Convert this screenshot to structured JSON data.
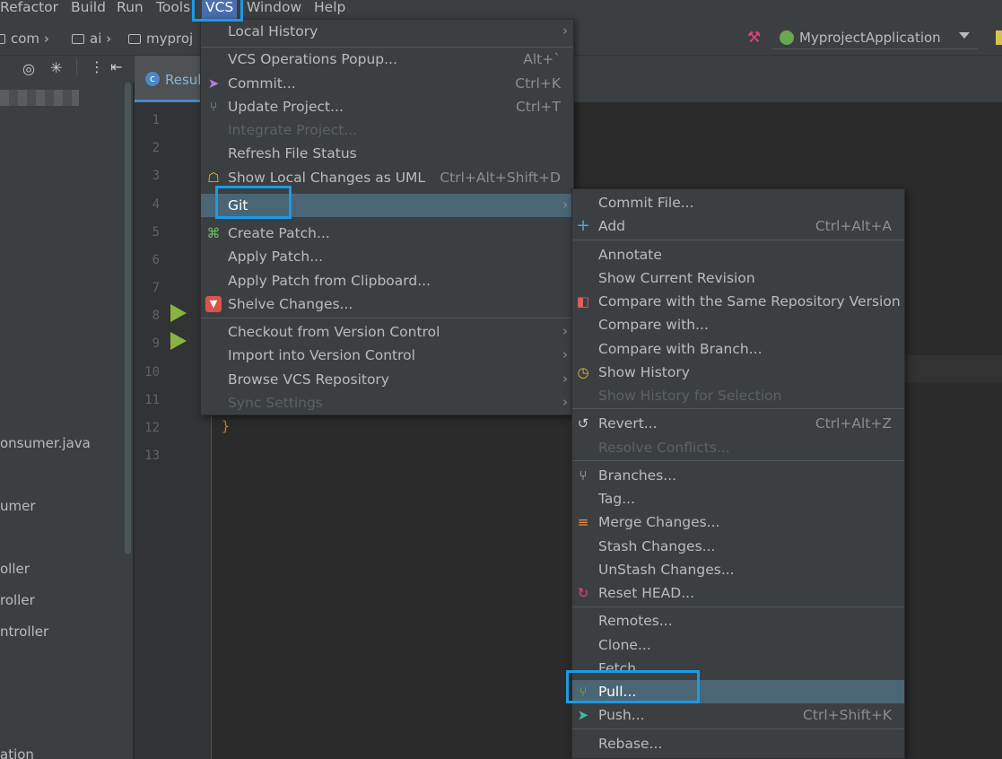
{
  "menubar": {
    "items": [
      {
        "label": "Refactor"
      },
      {
        "label": "Build"
      },
      {
        "label": "Run"
      },
      {
        "label": "Tools"
      },
      {
        "label": "VCS"
      },
      {
        "label": "Window"
      },
      {
        "label": "Help"
      }
    ]
  },
  "breadcrumbs": [
    "com",
    "ai",
    "myproj"
  ],
  "run_config": {
    "label": "MyprojectApplication"
  },
  "editor_tab": {
    "label": "Resul"
  },
  "project_tree": [
    "onsumer.java",
    "umer",
    "oller",
    "roller",
    "ntroller",
    "ation"
  ],
  "line_numbers": [
    "1",
    "2",
    "3",
    "4",
    "5",
    "6",
    "7",
    "8",
    "9",
    "10",
    "11",
    "12",
    "13"
  ],
  "code": {
    "closing_brace": "}"
  },
  "vcs_menu": {
    "items": [
      {
        "label": "Local History",
        "shortcut": "",
        "submenu": true
      },
      {
        "label": "VCS Operations Popup...",
        "shortcut": "Alt+`"
      },
      {
        "label": "Commit...",
        "shortcut": "Ctrl+K",
        "icon": "commit-icon"
      },
      {
        "label": "Update Project...",
        "shortcut": "Ctrl+T",
        "icon": "update-icon"
      },
      {
        "label": "Integrate Project...",
        "shortcut": "",
        "disabled": true
      },
      {
        "label": "Refresh File Status",
        "shortcut": ""
      },
      {
        "label": "Show Local Changes as UML",
        "shortcut": "Ctrl+Alt+Shift+D",
        "icon": "uml-icon"
      },
      {
        "label": "Git",
        "shortcut": "",
        "submenu": true,
        "selected": true
      },
      {
        "label": "Create Patch...",
        "shortcut": "",
        "icon": "patch-icon"
      },
      {
        "label": "Apply Patch...",
        "shortcut": ""
      },
      {
        "label": "Apply Patch from Clipboard...",
        "shortcut": ""
      },
      {
        "label": "Shelve Changes...",
        "shortcut": "",
        "icon": "shelve-icon"
      },
      {
        "label": "Checkout from Version Control",
        "shortcut": "",
        "submenu": true
      },
      {
        "label": "Import into Version Control",
        "shortcut": "",
        "submenu": true
      },
      {
        "label": "Browse VCS Repository",
        "shortcut": "",
        "submenu": true
      },
      {
        "label": "Sync Settings",
        "shortcut": "",
        "submenu": true,
        "disabled": true
      }
    ]
  },
  "git_menu": {
    "items": [
      {
        "label": "Commit File...",
        "shortcut": ""
      },
      {
        "label": "Add",
        "shortcut": "Ctrl+Alt+A",
        "icon": "plus-icon"
      },
      {
        "label": "Annotate",
        "shortcut": ""
      },
      {
        "label": "Show Current Revision",
        "shortcut": ""
      },
      {
        "label": "Compare with the Same Repository Version",
        "shortcut": "",
        "icon": "compare-icon"
      },
      {
        "label": "Compare with...",
        "shortcut": ""
      },
      {
        "label": "Compare with Branch...",
        "shortcut": ""
      },
      {
        "label": "Show History",
        "shortcut": "",
        "icon": "history-icon"
      },
      {
        "label": "Show History for Selection",
        "shortcut": "",
        "disabled": true
      },
      {
        "label": "Revert...",
        "shortcut": "Ctrl+Alt+Z",
        "icon": "revert-icon"
      },
      {
        "label": "Resolve Conflicts...",
        "shortcut": "",
        "disabled": true
      },
      {
        "label": "Branches...",
        "shortcut": "",
        "icon": "branches-icon"
      },
      {
        "label": "Tag...",
        "shortcut": ""
      },
      {
        "label": "Merge Changes...",
        "shortcut": "",
        "icon": "merge-icon"
      },
      {
        "label": "Stash Changes...",
        "shortcut": ""
      },
      {
        "label": "UnStash Changes...",
        "shortcut": ""
      },
      {
        "label": "Reset HEAD...",
        "shortcut": "",
        "icon": "reset-icon"
      },
      {
        "label": "Remotes...",
        "shortcut": ""
      },
      {
        "label": "Clone...",
        "shortcut": ""
      },
      {
        "label": "Fetch",
        "shortcut": ""
      },
      {
        "label": "Pull...",
        "shortcut": "",
        "icon": "pull-icon",
        "selected": true
      },
      {
        "label": "Push...",
        "shortcut": "Ctrl+Shift+K",
        "icon": "push-icon"
      },
      {
        "label": "Rebase...",
        "shortcut": ""
      }
    ]
  },
  "colors": {
    "highlight_box": "#1a9be6",
    "selection": "#4a6575",
    "menu_bg": "#3c3f41",
    "editor_bg": "#2b2b2b",
    "run_gutter": "#89b43f"
  }
}
